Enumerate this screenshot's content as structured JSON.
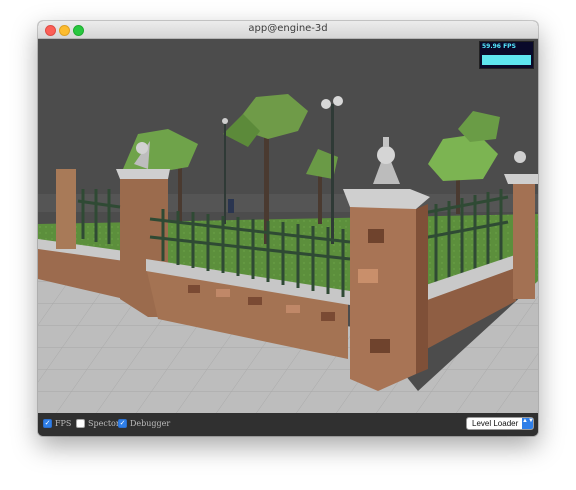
{
  "window": {
    "title": "app@engine-3d"
  },
  "fps_meter": {
    "label": "59.96 FPS"
  },
  "options": [
    {
      "label": "FPS",
      "checked": true
    },
    {
      "label": "Spector",
      "checked": false
    },
    {
      "label": "Debugger",
      "checked": true
    }
  ],
  "level_select": {
    "selected": "Level Loader"
  },
  "icons": {
    "checkbox_check": "✓",
    "select_arrows": "▲▼"
  },
  "colors": {
    "accent": "#2f7fe8",
    "fps_text": "#54e8ff",
    "fps_graph": "#5fe6f0",
    "close": "#fc5f57",
    "minimize": "#fdbc2e",
    "maximize": "#28c840"
  }
}
